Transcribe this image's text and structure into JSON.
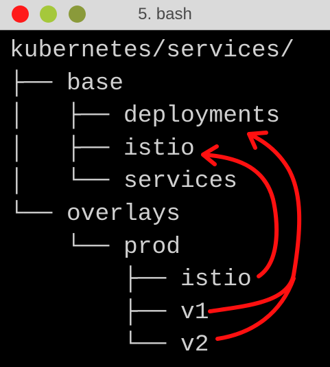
{
  "window": {
    "title": "5. bash",
    "buttons": {
      "close": "#ff1a1a",
      "minimize": "#a5c83b",
      "maximize": "#8a9a3a"
    }
  },
  "tree": {
    "lines": [
      {
        "prefix": "",
        "name": "kubernetes/services/"
      },
      {
        "prefix": "├── ",
        "name": "base"
      },
      {
        "prefix": "│   ├── ",
        "name": "deployments"
      },
      {
        "prefix": "│   ├── ",
        "name": "istio"
      },
      {
        "prefix": "│   └── ",
        "name": "services"
      },
      {
        "prefix": "└── ",
        "name": "overlays"
      },
      {
        "prefix": "    └── ",
        "name": "prod"
      },
      {
        "prefix": "        ├── ",
        "name": "istio"
      },
      {
        "prefix": "        ├── ",
        "name": "v1"
      },
      {
        "prefix": "        └── ",
        "name": "v2"
      }
    ]
  },
  "annotations": {
    "arrow_color": "#ff1010"
  }
}
